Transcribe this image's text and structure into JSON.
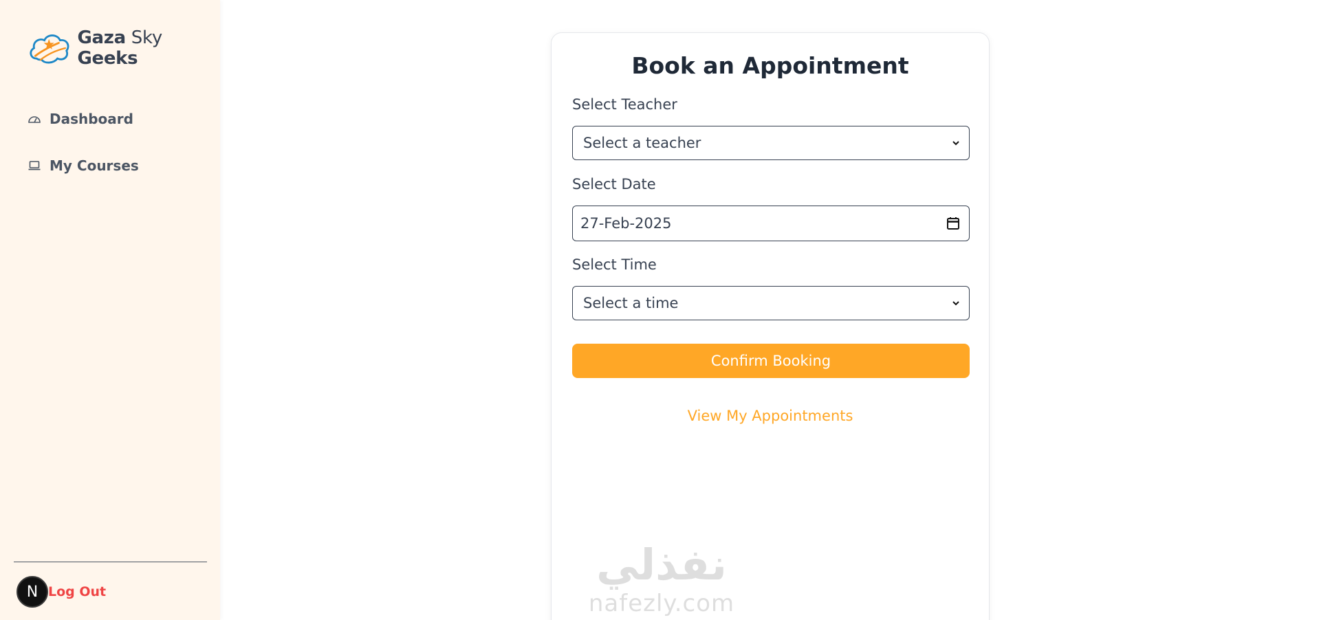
{
  "brand": {
    "name_part1": "Gaza",
    "name_part2": "Sky",
    "name_part3": "Geeks"
  },
  "sidebar": {
    "items": [
      {
        "label": "Dashboard",
        "icon": "gauge-icon"
      },
      {
        "label": "My Courses",
        "icon": "laptop-icon"
      }
    ],
    "logout_label": "Log Out",
    "avatar_letter": "N"
  },
  "booking": {
    "title": "Book an Appointment",
    "teacher_label": "Select Teacher",
    "teacher_value": "Select a teacher",
    "date_label": "Select Date",
    "date_value": "27-Feb-2025",
    "time_label": "Select Time",
    "time_value": "Select a time",
    "confirm_label": "Confirm Booking",
    "view_link": "View My Appointments"
  },
  "watermark": {
    "arabic": "نفذلي",
    "latin": "nafezly.com"
  },
  "colors": {
    "accent": "#ffa726",
    "sidebar_bg": "#fff6ec",
    "logout": "#ef4444"
  }
}
